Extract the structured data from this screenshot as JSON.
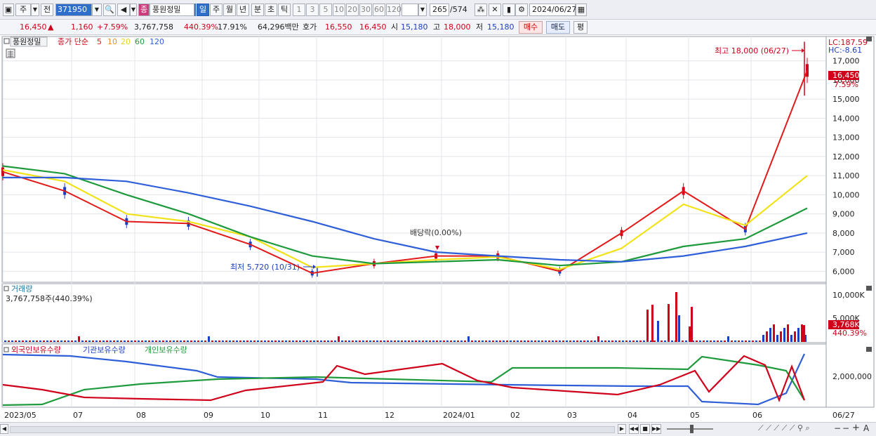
{
  "toolbar": {
    "period_main": "주",
    "prev_label": "전",
    "code": "371950",
    "stock_badge": "종",
    "stock_name": "풍원정밀",
    "periods": [
      "일",
      "주",
      "월",
      "년",
      "분",
      "초",
      "틱"
    ],
    "intervals": [
      "1",
      "3",
      "5",
      "10",
      "20",
      "30",
      "60",
      "120"
    ],
    "count": "265",
    "count_total": "/574",
    "date": "2024/06/27"
  },
  "info": {
    "price": "16,450",
    "arrow": "▲",
    "change": "1,160",
    "change_pct": "+7.59%",
    "volume": "3,767,758",
    "volume_pct": "440.39%",
    "turnover": "17.91%",
    "amount": "64,296백만",
    "quote_label": "호가",
    "ask": "16,550",
    "bid": "16,450",
    "open_label": "시",
    "open": "15,180",
    "high_label": "고",
    "high": "18,000",
    "low_label": "저",
    "low": "15,180",
    "buy_label": "매수",
    "sell_label": "매도",
    "avg_label": "평"
  },
  "price_panel": {
    "legend_name": "풍원정밀",
    "legend_close": "종가 단순",
    "ma_periods": [
      "5",
      "10",
      "20",
      "60",
      "120"
    ],
    "lc_label": "LC:187.59",
    "hc_label": "HC:-8.61",
    "current_price_tag": "16,450",
    "current_pct_tag": "7.59%",
    "high_annotation": "최고 18,000 (06/27)",
    "low_annotation": "최저 5,720 (10/31)",
    "dividend_annotation": "배당락(0.00%)",
    "y_ticks": [
      "17,000",
      "16,000",
      "15,000",
      "14,000",
      "13,000",
      "12,000",
      "11,000",
      "10,000",
      "9,000",
      "8,000",
      "7,000",
      "6,000"
    ]
  },
  "volume_panel": {
    "title": "거래량",
    "value": "3,767,758주(440.39%)",
    "y_ticks": [
      "10,000K",
      "5,000K"
    ],
    "current_tag": "3,768K",
    "current_pct": "440.39%"
  },
  "holding_panel": {
    "legends": [
      "외국인보유수량",
      "기관보유수량",
      "개인보유수량"
    ],
    "y_tick": "2,000,000"
  },
  "x_labels": [
    "2023/05",
    "07",
    "08",
    "09",
    "10",
    "11",
    "12",
    "2024/01",
    "02",
    "03",
    "04",
    "05",
    "06",
    "06/27"
  ],
  "colors": {
    "ma5": "#e21a1a",
    "ma10": "#f08c1e",
    "ma20": "#f2e21a",
    "ma60": "#1f9a3c",
    "ma120": "#2f5fd8",
    "up": "#d0021b",
    "down": "#1a3fbf"
  },
  "chart_data": {
    "type": "line",
    "title": "풍원정밀",
    "x": [
      "2023/05",
      "07",
      "08",
      "09",
      "10",
      "11",
      "12",
      "2024/01",
      "02",
      "03",
      "04",
      "05",
      "06",
      "06/27"
    ],
    "ylim": [
      5500,
      18200
    ],
    "series": [
      {
        "name": "5",
        "values": [
          11200,
          10200,
          8600,
          8500,
          7400,
          5900,
          6400,
          6800,
          6800,
          6000,
          8000,
          10200,
          8200,
          16500
        ]
      },
      {
        "name": "20",
        "values": [
          11300,
          10700,
          9000,
          8600,
          7800,
          6200,
          6400,
          6600,
          6750,
          6100,
          7200,
          9500,
          8400,
          11000
        ]
      },
      {
        "name": "60",
        "values": [
          11500,
          11100,
          10000,
          9000,
          7800,
          6800,
          6400,
          6500,
          6600,
          6300,
          6500,
          7300,
          7700,
          9300
        ]
      },
      {
        "name": "120",
        "values": [
          10900,
          10900,
          10700,
          10100,
          9400,
          8600,
          7700,
          7000,
          6800,
          6600,
          6500,
          6800,
          7300,
          8000
        ]
      }
    ],
    "high": {
      "label": "최고",
      "value": 18000,
      "date": "06/27"
    },
    "low": {
      "label": "최저",
      "value": 5720,
      "date": "10/31"
    }
  }
}
